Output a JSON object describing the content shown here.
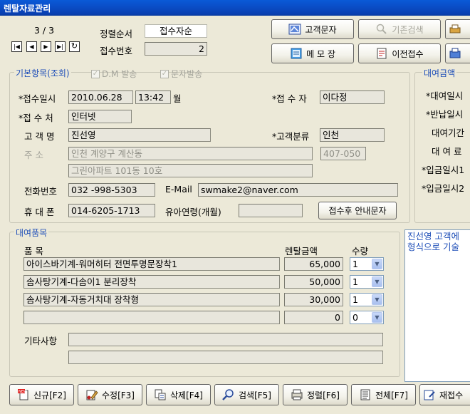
{
  "window": {
    "title": "렌탈자료관리"
  },
  "nav": {
    "position": "3 / 3"
  },
  "sort": {
    "label": "정렬순서",
    "value": "접수자순"
  },
  "receipt": {
    "label": "접수번호",
    "value": "2"
  },
  "toolbar": {
    "customer_sms": "고객문자",
    "existing_search": "기존검색",
    "memo": "메 모 장",
    "prev_receipt": "이전접수"
  },
  "basic": {
    "title": "기본항목(조회)",
    "dm_send": "D.M 발송",
    "sms_send": "문자발송",
    "received_date_label": "*접수일시",
    "received_date": "2010.06.28",
    "received_time": "13:42",
    "received_day": "월",
    "receiver_label": "*접 수 자",
    "receiver": "이다정",
    "channel_label": "*접 수 처",
    "channel": "인터넷",
    "customer_label": "고 객 명",
    "customer": "진선영",
    "category_label": "*고객분류",
    "category": "인천",
    "address_label": "주     소",
    "address1": "인천 계양구 계산동",
    "zip": "407-050",
    "address2": "그린아파트 101동 10호",
    "phone_label": "전화번호",
    "phone": "032 -998-5303",
    "email_label": "E-Mail",
    "email": "swmake2@naver.com",
    "mobile_label": "휴 대 폰",
    "mobile": "014-6205-1713",
    "infant_label": "유아연령(개월)",
    "infant": "",
    "guide_sms_button": "접수후 안내문자"
  },
  "rental": {
    "title": "대여금액",
    "items": [
      "*대여일시",
      "*반납일시",
      "대여기간",
      "대 여 료",
      "*입금일시1",
      "*입금일시2"
    ]
  },
  "products": {
    "title": "대여품목",
    "col_item": "품     목",
    "col_price": "렌탈금액",
    "col_qty": "수량",
    "rows": [
      {
        "name": "아이스바기계-워머히터 전면투명문장착1",
        "price": "65,000",
        "qty": "1"
      },
      {
        "name": "솜사탕기계-다솜이1 분리장착",
        "price": "50,000",
        "qty": "1"
      },
      {
        "name": "솜사탕기계-자동거치대 장착형",
        "price": "30,000",
        "qty": "1"
      },
      {
        "name": "",
        "price": "0",
        "qty": "0"
      }
    ],
    "misc_label": "기타사항",
    "misc1": "",
    "misc2": ""
  },
  "memo": {
    "line1": "진선영 고객에",
    "line2": "형식으로 기술"
  },
  "bottom": {
    "new": "신규[F2]",
    "edit": "수정[F3]",
    "delete": "삭제[F4]",
    "search": "검색[F5]",
    "sort": "정렬[F6]",
    "all": "전체[F7]",
    "rereceipt": "재접수"
  }
}
